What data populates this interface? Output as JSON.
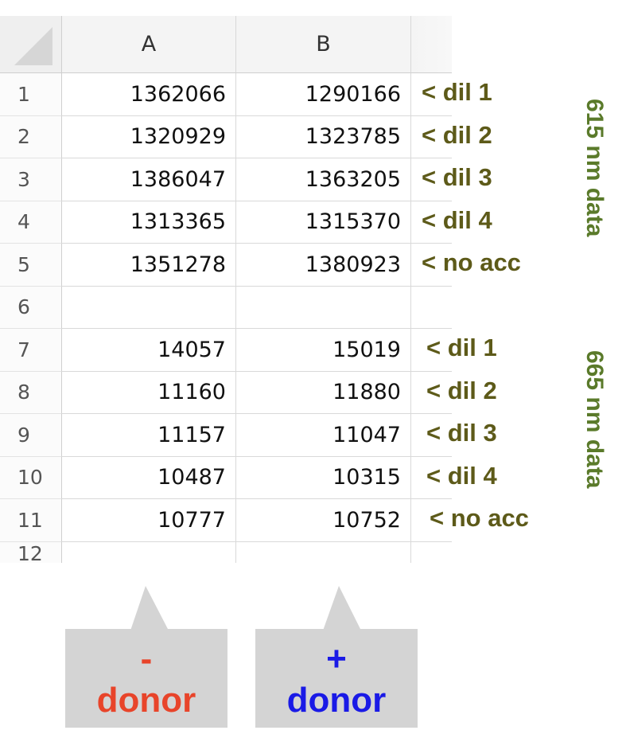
{
  "columns": [
    "A",
    "B"
  ],
  "rows": [
    {
      "num": "1",
      "a": "1362066",
      "b": "1290166",
      "note": "< dil 1"
    },
    {
      "num": "2",
      "a": "1320929",
      "b": "1323785",
      "note": "< dil 2"
    },
    {
      "num": "3",
      "a": "1386047",
      "b": "1363205",
      "note": "< dil 3"
    },
    {
      "num": "4",
      "a": "1313365",
      "b": "1315370",
      "note": "< dil 4"
    },
    {
      "num": "5",
      "a": "1351278",
      "b": "1380923",
      "note": "< no acc"
    },
    {
      "num": "6",
      "a": "",
      "b": "",
      "note": ""
    },
    {
      "num": "7",
      "a": "14057",
      "b": "15019",
      "note": "< dil 1"
    },
    {
      "num": "8",
      "a": "11160",
      "b": "11880",
      "note": "< dil 2"
    },
    {
      "num": "9",
      "a": "11157",
      "b": "11047",
      "note": "< dil 3"
    },
    {
      "num": "10",
      "a": "10487",
      "b": "10315",
      "note": "< dil 4"
    },
    {
      "num": "11",
      "a": "10777",
      "b": "10752",
      "note": "< no acc"
    },
    {
      "num": "12",
      "a": "",
      "b": "",
      "note": ""
    }
  ],
  "side_labels": {
    "top": "615 nm data",
    "bottom": "665 nm data"
  },
  "callouts": {
    "minus": {
      "sign": "-",
      "label": "donor",
      "color": "#e8442a"
    },
    "plus": {
      "sign": "+",
      "label": "donor",
      "color": "#1a1ae6"
    }
  },
  "colors": {
    "note": "#5d5a19",
    "side_label": "#5a7a2a",
    "callout_bg": "#d4d4d4"
  }
}
